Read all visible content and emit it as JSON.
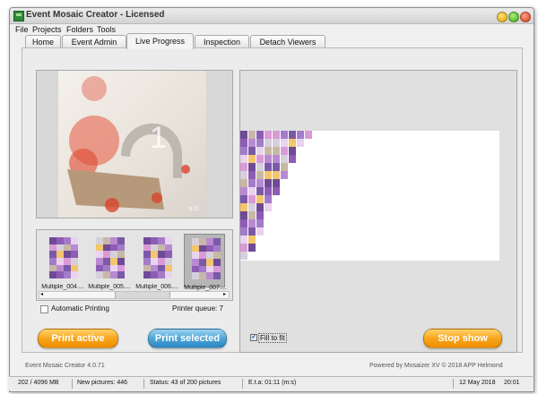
{
  "window": {
    "title": "Event Mosaic Creator - Licensed"
  },
  "menu": [
    "File",
    "Projects",
    "Folders",
    "Tools"
  ],
  "tabs": [
    "Home",
    "Event Admin",
    "Live Progress",
    "Inspection",
    "Detach Viewers"
  ],
  "active_tab": "Live Progress",
  "preview": {
    "number": "1",
    "watermark": "K O"
  },
  "thumbnails": [
    {
      "label": "Multiple_004...."
    },
    {
      "label": "Multiple_005...."
    },
    {
      "label": "Multiple_006...."
    },
    {
      "label": "Multiple_007...."
    }
  ],
  "options": {
    "auto_printing_label": "Automatic Printing",
    "printer_queue_label": "Printer queue: 7",
    "fill_to_fit_label": "Fill to fit"
  },
  "buttons": {
    "print_active": "Print active",
    "print_selected": "Print selected",
    "stop_show": "Stop show"
  },
  "footer": {
    "version": "Event Mosaic Creator 4.0.71",
    "powered_by": "Powered by Mosaizer XV © 2018 APP Helmond"
  },
  "statusbar": {
    "memory": "202 / 4096 MB",
    "new_pictures": "New pictures: 446",
    "status": "Status: 43 of 200 pictures",
    "eta": "E.t.a: 01:11 (m:s)",
    "date": "12 May 2018",
    "time": "20:01"
  },
  "colors": {
    "orange_button": "#f8a51d",
    "blue_button": "#4ea6d8",
    "tile_purple": "#8e5bb5",
    "tile_pink": "#d99ad6"
  }
}
